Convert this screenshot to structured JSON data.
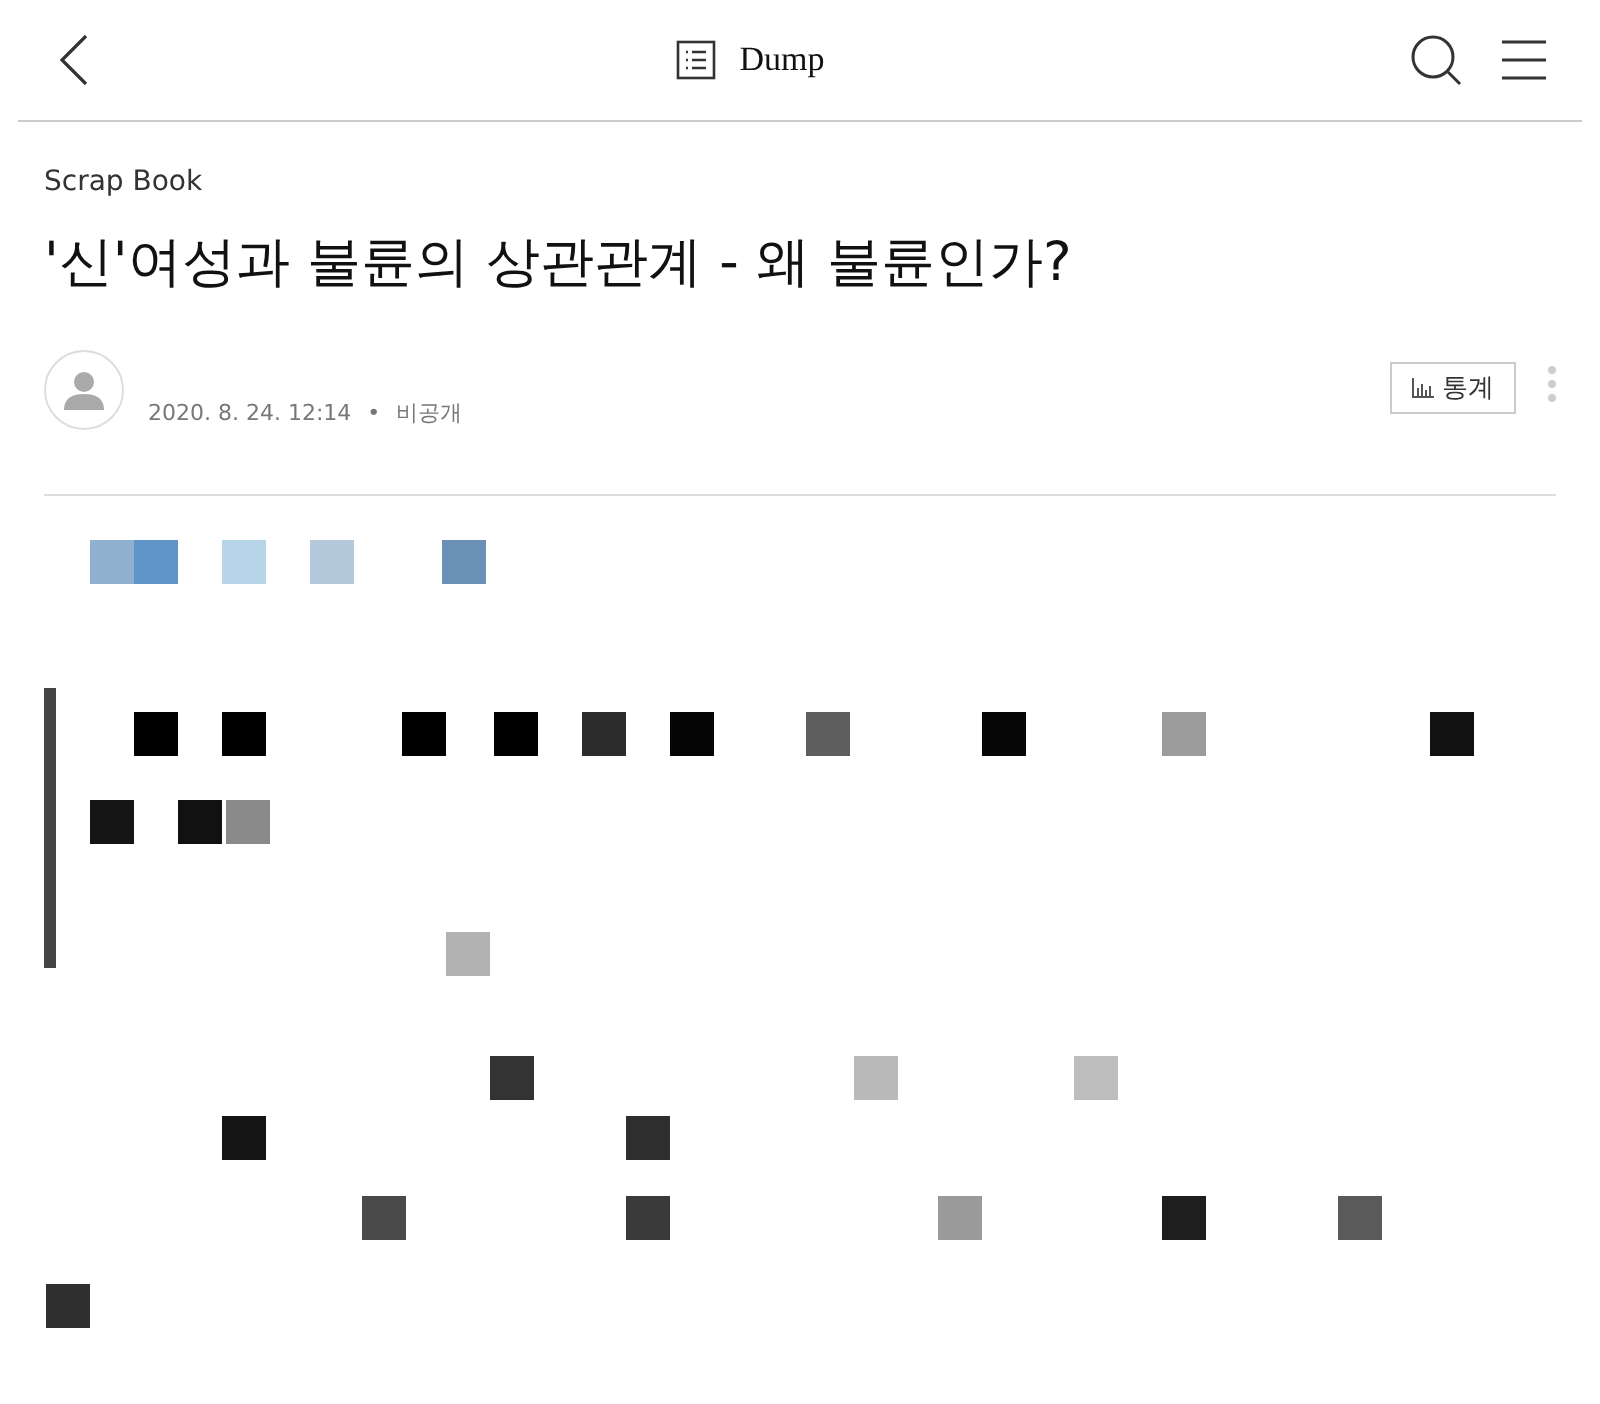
{
  "header": {
    "title": "Dump"
  },
  "post": {
    "category": "Scrap Book",
    "title": "'신'여성과 불륜의 상관관계 - 왜 불륜인가?",
    "date": "2020. 8. 24. 12:14",
    "separator": "•",
    "visibility": "비공개",
    "stats_button": "통계"
  }
}
